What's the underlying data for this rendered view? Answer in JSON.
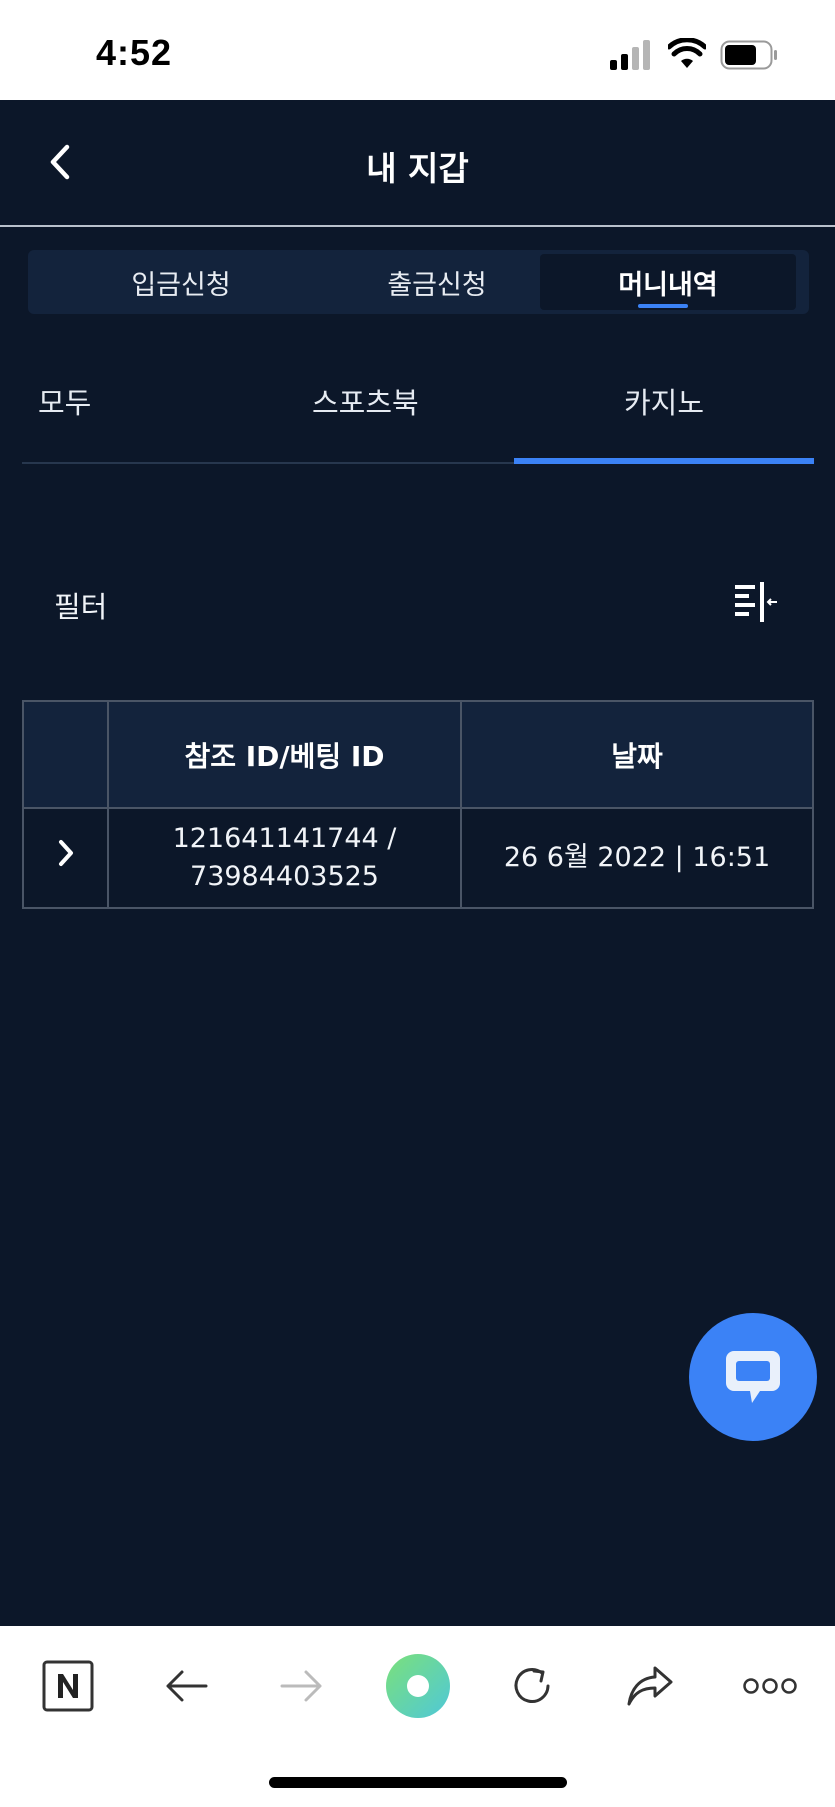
{
  "status_bar": {
    "time": "4:52"
  },
  "header": {
    "title": "내 지갑"
  },
  "segment_tabs": [
    {
      "label": "입금신청",
      "active": false
    },
    {
      "label": "출금신청",
      "active": false
    },
    {
      "label": "머니내역",
      "active": true
    }
  ],
  "category_tabs": [
    {
      "label": "모두",
      "active": false
    },
    {
      "label": "스포츠북",
      "active": false
    },
    {
      "label": "카지노",
      "active": true
    }
  ],
  "filter": {
    "label": "필터"
  },
  "table": {
    "headers": [
      "참조 ID/베팅 ID",
      "날짜"
    ],
    "rows": [
      {
        "ref_line1": "121641141744 /",
        "ref_line2": "73984403525",
        "date": "26 6월 2022 | 16:51"
      }
    ]
  },
  "colors": {
    "background": "#0c1729",
    "panel": "#13233c",
    "accent": "#3b82f6"
  },
  "icons": [
    "back-icon",
    "filter-icon",
    "chat-icon",
    "naver-icon",
    "browser-back-icon",
    "browser-forward-icon",
    "browser-home-icon",
    "reload-icon",
    "share-icon",
    "more-icon"
  ]
}
